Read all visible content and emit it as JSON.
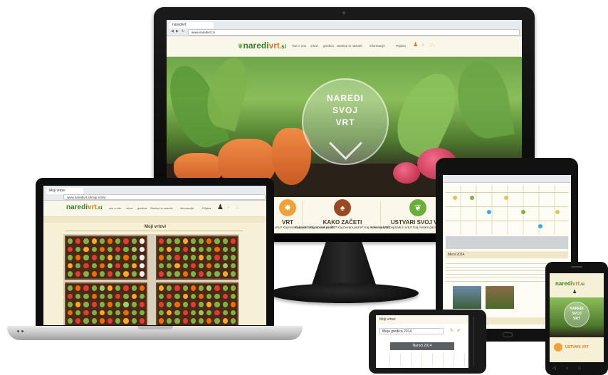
{
  "monitor": {
    "tab_label": "naredivrt",
    "url": "www.naredivrt.si",
    "logo_main": "naredi",
    "logo_accent": "vrt",
    "logo_suffix": ".si",
    "nav": [
      "Vse o vrtu",
      "vrtovi",
      "gredica",
      "Storitve in nasveti",
      "informacije",
      "Prijava"
    ],
    "hero_lines": [
      "NAREDI",
      "SVOJ",
      "VRT"
    ],
    "features": [
      {
        "title": "VRT",
        "text": "Kako se lotiti pripravk in vrtu? Kaj moram paziti? Kaj moram paziti?"
      },
      {
        "title": "KAKO ZAČETI",
        "text": "Kako se lotiti pripravk in vrtu? Kaj moram paziti? Kaj moram paziti?"
      },
      {
        "title": "USTVARI SVOJ VRT",
        "text": "Kako se lotiti pripravk in vrtu? Kaj moram paziti? Kaj moram paziti?"
      }
    ]
  },
  "laptop": {
    "tab_label": "Moji vrtovi",
    "url": "www.naredivrt.si/moji-vrtovi",
    "logo_main": "naredi",
    "logo_accent": "vrt",
    "logo_suffix": ".si",
    "nav": [
      "vse o vrtu",
      "vrtovi",
      "gredica",
      "Storitve in nasveti",
      "informacije",
      "Prijava"
    ],
    "page_title": "Moji vrtovi"
  },
  "tablet": {
    "section_title": "Meni 2014"
  },
  "phone1": {
    "header": "Moji vrtovi",
    "field": "Moja gredica 2014",
    "button": "Naroči 2014"
  },
  "phone2": {
    "logo_main": "naredi",
    "logo_accent": "vrt",
    "logo_suffix": ".si",
    "hero_lines": [
      "NAREDI",
      "SVOJ",
      "VRT"
    ],
    "feature": "USTVARI VRT"
  },
  "colors": {
    "brand_green": "#3b7d2a",
    "brand_orange": "#e07a23",
    "bed_brown": "#4a2a17",
    "cream": "#f6f0d7"
  },
  "icons": [
    "tomato-icon",
    "spade-icon",
    "seedling-icon",
    "basket-icon",
    "user-icon"
  ]
}
